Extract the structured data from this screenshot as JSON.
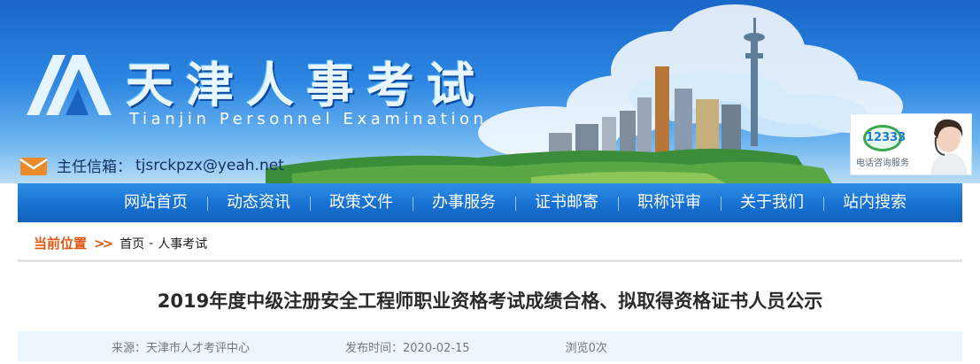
{
  "header": {
    "site_title": "天津人事考试",
    "site_subtitle": "Tianjin Personnel Examination",
    "mailbox_label": "主任信箱：",
    "mailbox_value": "tjsrckpzx@yeah.net",
    "hotline_number": "12333",
    "hotline_text": "电话咨询服务"
  },
  "nav": {
    "items": [
      "网站首页",
      "动态资讯",
      "政策文件",
      "办事服务",
      "证书邮寄",
      "职称评审",
      "关于我们",
      "站内搜索"
    ]
  },
  "breadcrumb": {
    "label": "当前位置",
    "arrow": ">>",
    "home": "首页",
    "separator": "-",
    "current": "人事考试"
  },
  "article": {
    "title": "2019年度中级注册安全工程师职业资格考试成绩合格、拟取得资格证书人员公示",
    "source": "来源：天津市人才考评中心",
    "published": "发布时间：2020-02-15",
    "views": "浏览0次"
  },
  "colors": {
    "nav_blue": "#1770d1",
    "breadcrumb_orange": "#e0550f",
    "meta_bg": "#eef6fd"
  }
}
